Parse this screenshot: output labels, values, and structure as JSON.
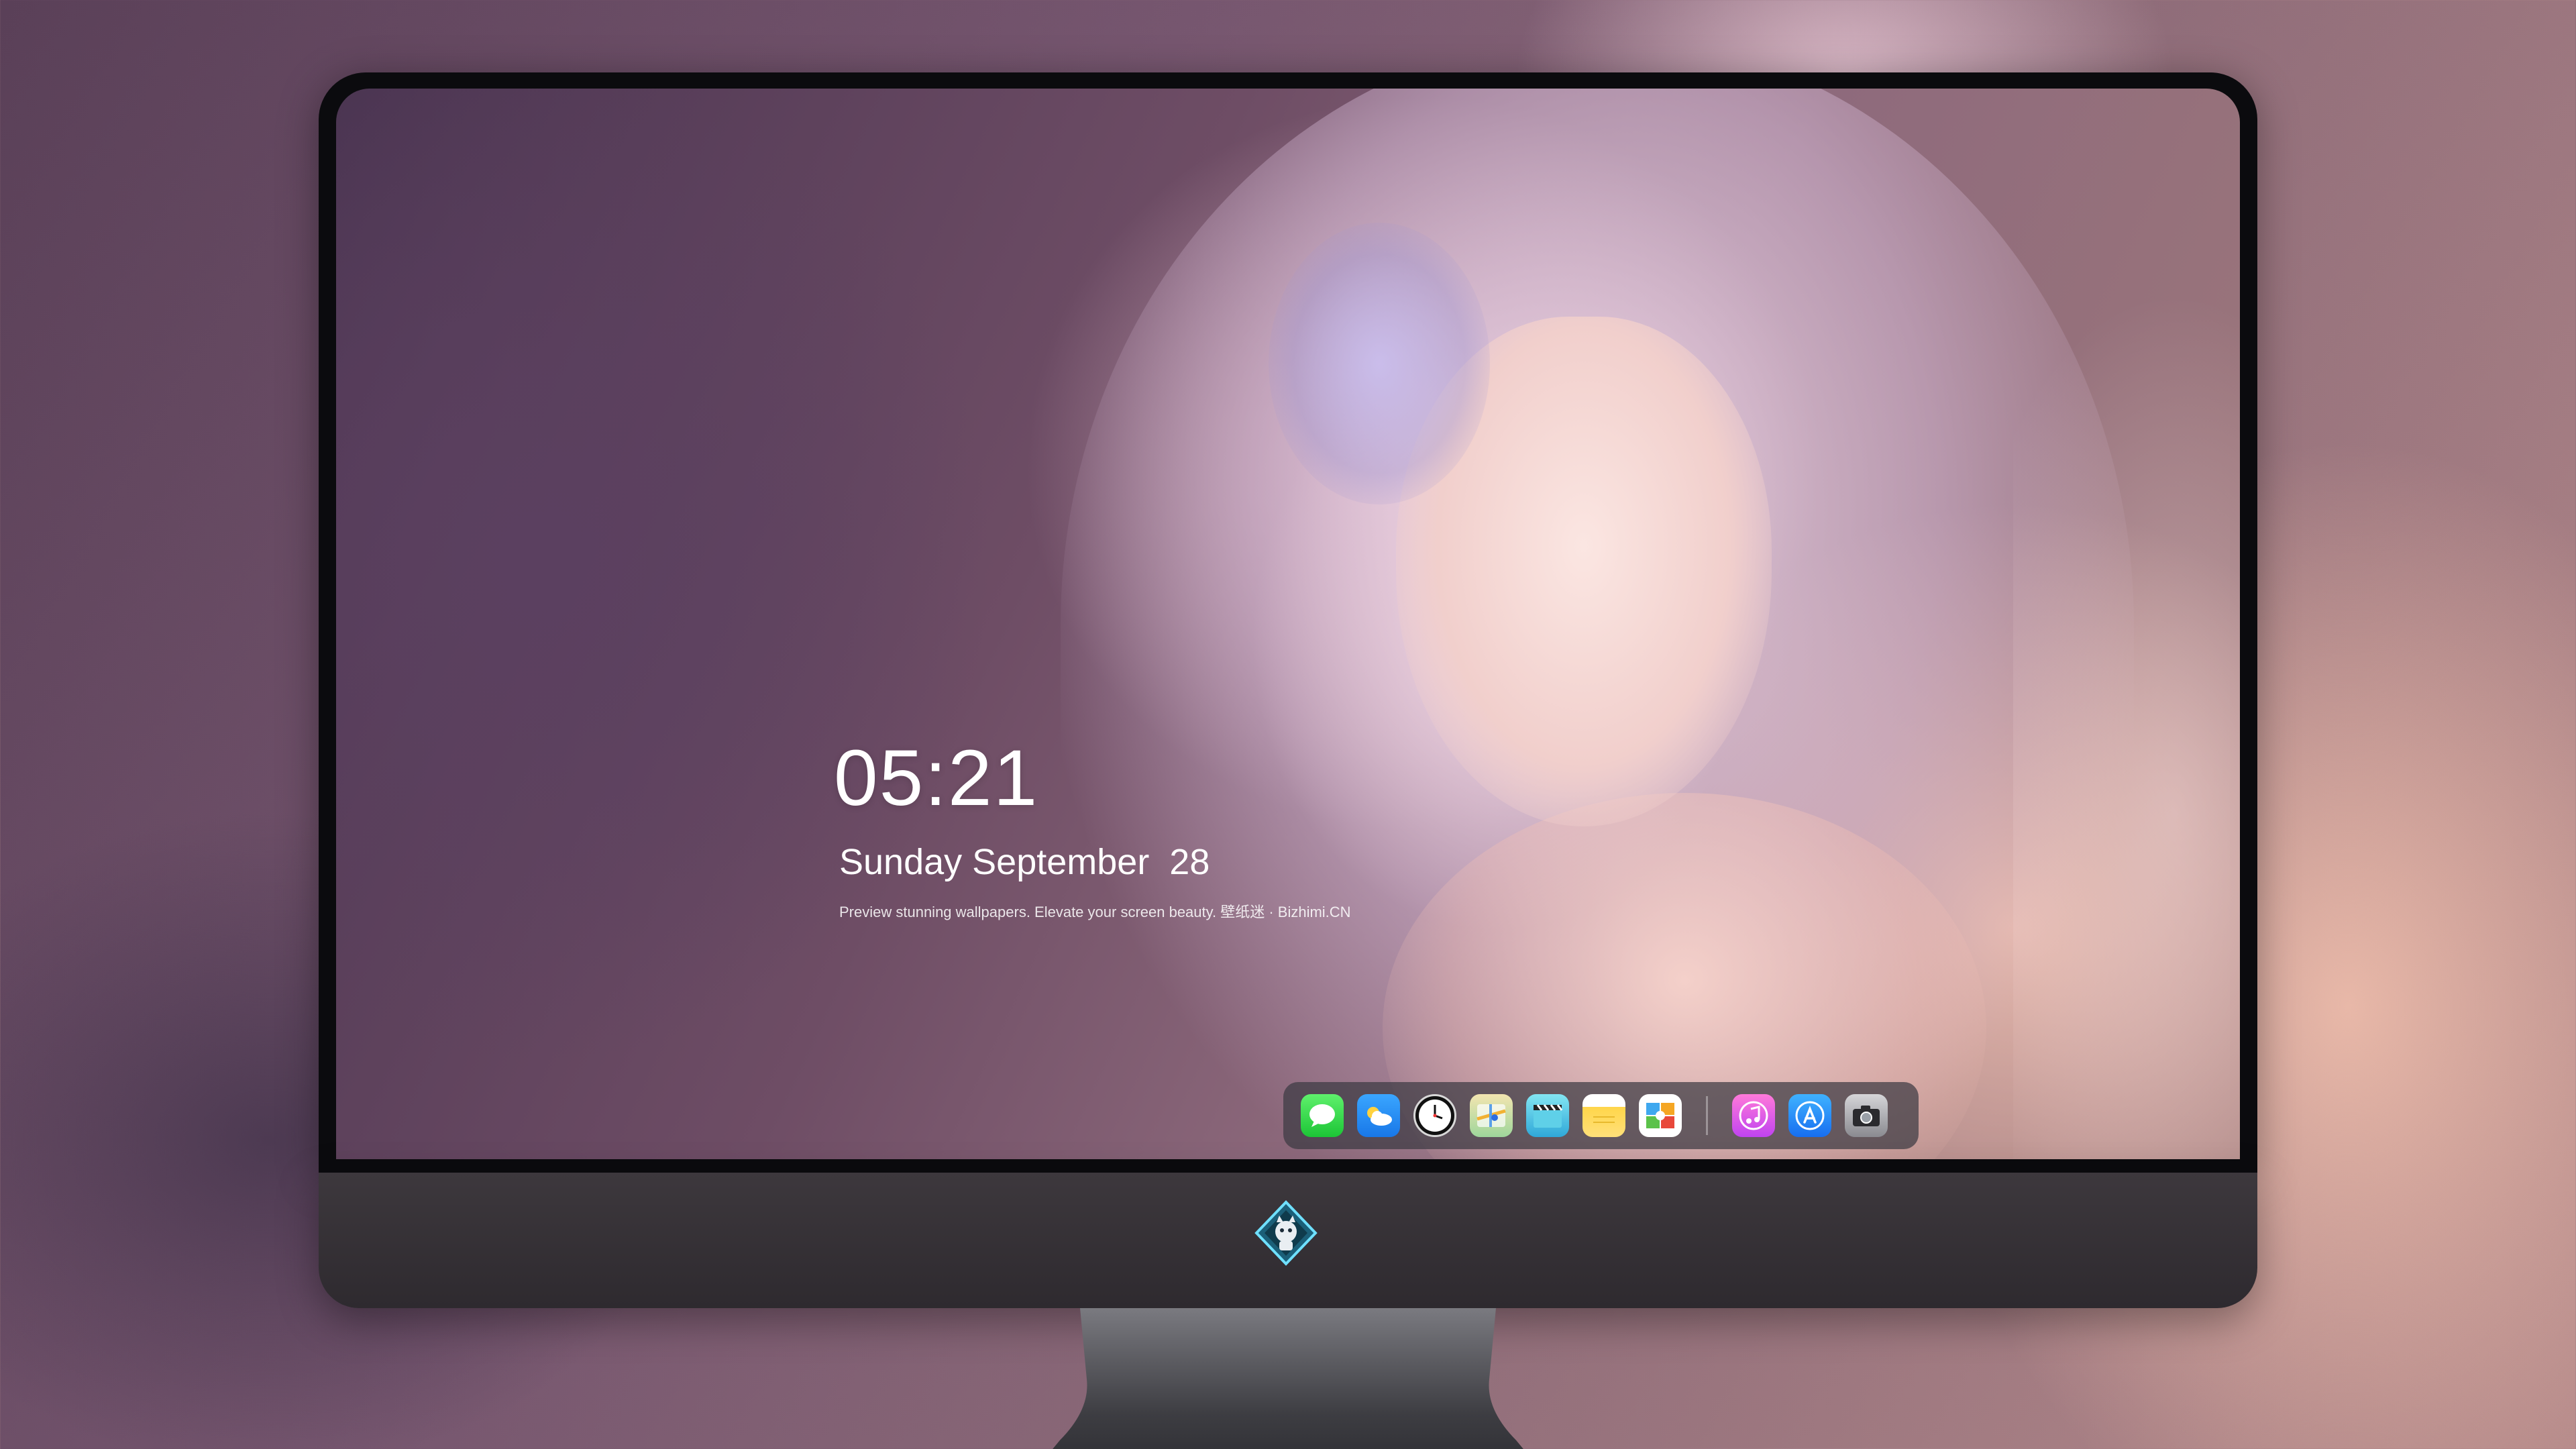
{
  "lockscreen": {
    "time": "05:21",
    "date": "Sunday September  28",
    "tagline": "Preview stunning wallpapers. Elevate your screen beauty. 壁纸迷 · Bizhimi.CN"
  },
  "dock": {
    "apps": [
      {
        "icon": "messages-icon"
      },
      {
        "icon": "weather-icon"
      },
      {
        "icon": "clock-icon"
      },
      {
        "icon": "maps-icon"
      },
      {
        "icon": "video-icon"
      },
      {
        "icon": "notes-icon"
      },
      {
        "icon": "photos-icon"
      },
      {
        "icon": "music-icon"
      },
      {
        "icon": "app-store-icon"
      },
      {
        "icon": "camera-icon"
      }
    ]
  },
  "colors": {
    "bezel": "#0b0b0e",
    "chin": "#3d383d",
    "dock_bg": "#3c3a42",
    "text": "#ffffff"
  }
}
